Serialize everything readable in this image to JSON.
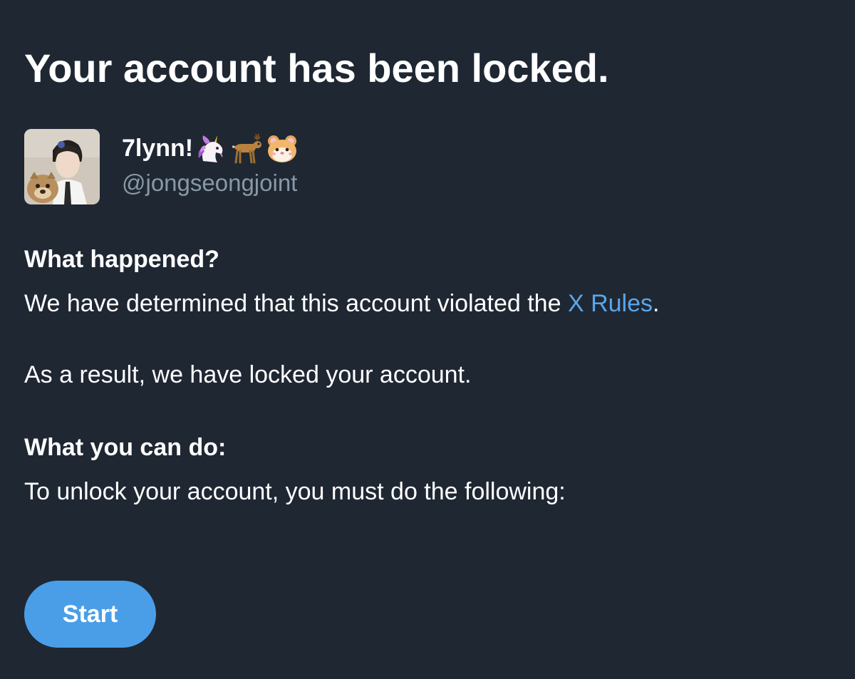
{
  "page": {
    "title": "Your account has been locked."
  },
  "account": {
    "display_name": "7lynn!",
    "emoji": [
      "unicorn",
      "deer",
      "hamster"
    ],
    "handle": "@jongseongjoint"
  },
  "what_happened": {
    "heading": "What happened?",
    "text_before_link": "We have determined that this account violated the ",
    "link_text": "X Rules",
    "text_after_link": ".",
    "result_text": "As a result, we have locked your account."
  },
  "what_you_can_do": {
    "heading": "What you can do:",
    "text": "To unlock your account, you must do the following:"
  },
  "actions": {
    "start_label": "Start"
  },
  "colors": {
    "background": "#1f2733",
    "text_primary": "#ffffff",
    "text_secondary": "#8899a6",
    "link": "#5aa6ea",
    "button": "#4a9ee8"
  }
}
